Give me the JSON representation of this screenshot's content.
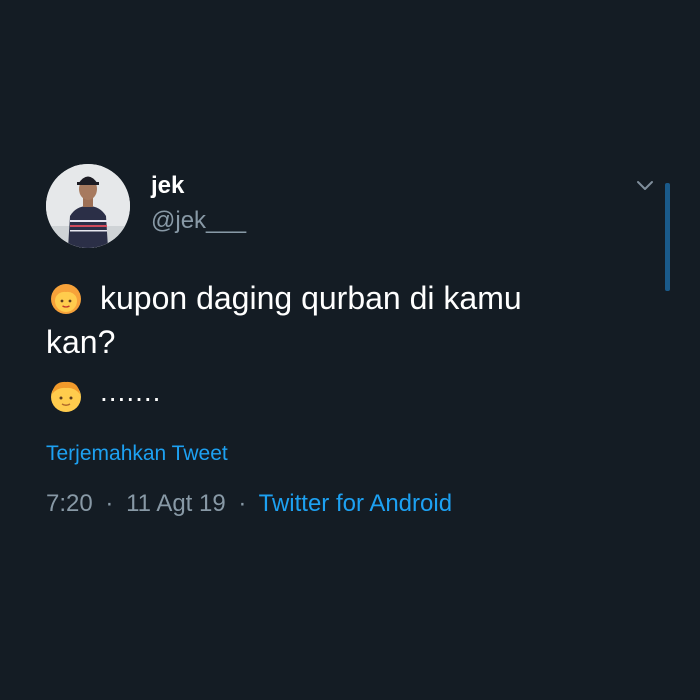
{
  "tweet": {
    "display_name": "jek",
    "handle": "@jek___",
    "text_line1": "kupon daging qurban di kamu",
    "text_line2": "kan?",
    "text_line3": ".......",
    "emoji1": "woman-emoji",
    "emoji2": "boy-emoji",
    "translate_label": "Terjemahkan Tweet",
    "time": "7:20",
    "date": "11 Agt 19",
    "separator": "·",
    "source": "Twitter for Android"
  },
  "icons": {
    "menu": "chevron-down-icon",
    "avatar": "avatar"
  },
  "colors": {
    "background": "#141c24",
    "link": "#1da1f2",
    "secondary_text": "#8899a6",
    "primary_text": "#ffffff"
  }
}
